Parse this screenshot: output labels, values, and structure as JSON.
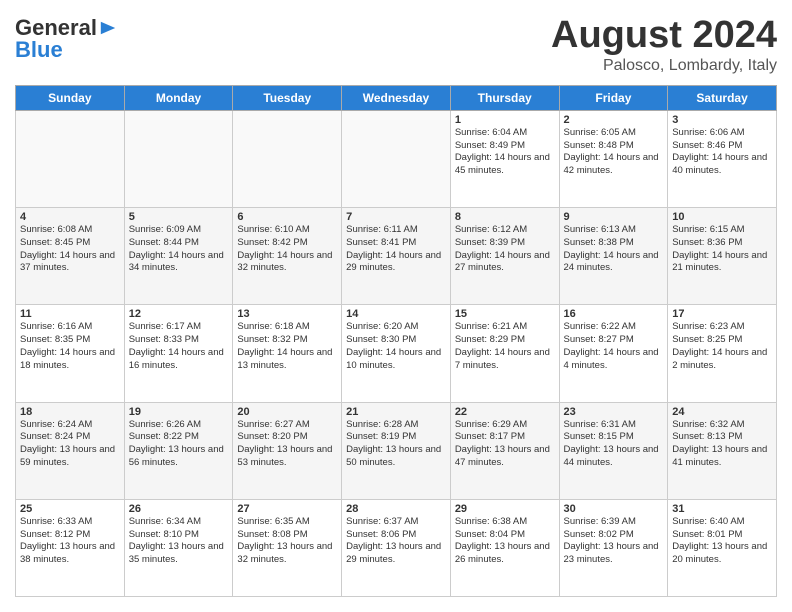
{
  "header": {
    "logo_line1": "General",
    "logo_line2": "Blue",
    "month_year": "August 2024",
    "location": "Palosco, Lombardy, Italy"
  },
  "days_of_week": [
    "Sunday",
    "Monday",
    "Tuesday",
    "Wednesday",
    "Thursday",
    "Friday",
    "Saturday"
  ],
  "weeks": [
    [
      {
        "day": "",
        "info": ""
      },
      {
        "day": "",
        "info": ""
      },
      {
        "day": "",
        "info": ""
      },
      {
        "day": "",
        "info": ""
      },
      {
        "day": "1",
        "info": "Sunrise: 6:04 AM\nSunset: 8:49 PM\nDaylight: 14 hours and 45 minutes."
      },
      {
        "day": "2",
        "info": "Sunrise: 6:05 AM\nSunset: 8:48 PM\nDaylight: 14 hours and 42 minutes."
      },
      {
        "day": "3",
        "info": "Sunrise: 6:06 AM\nSunset: 8:46 PM\nDaylight: 14 hours and 40 minutes."
      }
    ],
    [
      {
        "day": "4",
        "info": "Sunrise: 6:08 AM\nSunset: 8:45 PM\nDaylight: 14 hours and 37 minutes."
      },
      {
        "day": "5",
        "info": "Sunrise: 6:09 AM\nSunset: 8:44 PM\nDaylight: 14 hours and 34 minutes."
      },
      {
        "day": "6",
        "info": "Sunrise: 6:10 AM\nSunset: 8:42 PM\nDaylight: 14 hours and 32 minutes."
      },
      {
        "day": "7",
        "info": "Sunrise: 6:11 AM\nSunset: 8:41 PM\nDaylight: 14 hours and 29 minutes."
      },
      {
        "day": "8",
        "info": "Sunrise: 6:12 AM\nSunset: 8:39 PM\nDaylight: 14 hours and 27 minutes."
      },
      {
        "day": "9",
        "info": "Sunrise: 6:13 AM\nSunset: 8:38 PM\nDaylight: 14 hours and 24 minutes."
      },
      {
        "day": "10",
        "info": "Sunrise: 6:15 AM\nSunset: 8:36 PM\nDaylight: 14 hours and 21 minutes."
      }
    ],
    [
      {
        "day": "11",
        "info": "Sunrise: 6:16 AM\nSunset: 8:35 PM\nDaylight: 14 hours and 18 minutes."
      },
      {
        "day": "12",
        "info": "Sunrise: 6:17 AM\nSunset: 8:33 PM\nDaylight: 14 hours and 16 minutes."
      },
      {
        "day": "13",
        "info": "Sunrise: 6:18 AM\nSunset: 8:32 PM\nDaylight: 14 hours and 13 minutes."
      },
      {
        "day": "14",
        "info": "Sunrise: 6:20 AM\nSunset: 8:30 PM\nDaylight: 14 hours and 10 minutes."
      },
      {
        "day": "15",
        "info": "Sunrise: 6:21 AM\nSunset: 8:29 PM\nDaylight: 14 hours and 7 minutes."
      },
      {
        "day": "16",
        "info": "Sunrise: 6:22 AM\nSunset: 8:27 PM\nDaylight: 14 hours and 4 minutes."
      },
      {
        "day": "17",
        "info": "Sunrise: 6:23 AM\nSunset: 8:25 PM\nDaylight: 14 hours and 2 minutes."
      }
    ],
    [
      {
        "day": "18",
        "info": "Sunrise: 6:24 AM\nSunset: 8:24 PM\nDaylight: 13 hours and 59 minutes."
      },
      {
        "day": "19",
        "info": "Sunrise: 6:26 AM\nSunset: 8:22 PM\nDaylight: 13 hours and 56 minutes."
      },
      {
        "day": "20",
        "info": "Sunrise: 6:27 AM\nSunset: 8:20 PM\nDaylight: 13 hours and 53 minutes."
      },
      {
        "day": "21",
        "info": "Sunrise: 6:28 AM\nSunset: 8:19 PM\nDaylight: 13 hours and 50 minutes."
      },
      {
        "day": "22",
        "info": "Sunrise: 6:29 AM\nSunset: 8:17 PM\nDaylight: 13 hours and 47 minutes."
      },
      {
        "day": "23",
        "info": "Sunrise: 6:31 AM\nSunset: 8:15 PM\nDaylight: 13 hours and 44 minutes."
      },
      {
        "day": "24",
        "info": "Sunrise: 6:32 AM\nSunset: 8:13 PM\nDaylight: 13 hours and 41 minutes."
      }
    ],
    [
      {
        "day": "25",
        "info": "Sunrise: 6:33 AM\nSunset: 8:12 PM\nDaylight: 13 hours and 38 minutes."
      },
      {
        "day": "26",
        "info": "Sunrise: 6:34 AM\nSunset: 8:10 PM\nDaylight: 13 hours and 35 minutes."
      },
      {
        "day": "27",
        "info": "Sunrise: 6:35 AM\nSunset: 8:08 PM\nDaylight: 13 hours and 32 minutes."
      },
      {
        "day": "28",
        "info": "Sunrise: 6:37 AM\nSunset: 8:06 PM\nDaylight: 13 hours and 29 minutes."
      },
      {
        "day": "29",
        "info": "Sunrise: 6:38 AM\nSunset: 8:04 PM\nDaylight: 13 hours and 26 minutes."
      },
      {
        "day": "30",
        "info": "Sunrise: 6:39 AM\nSunset: 8:02 PM\nDaylight: 13 hours and 23 minutes."
      },
      {
        "day": "31",
        "info": "Sunrise: 6:40 AM\nSunset: 8:01 PM\nDaylight: 13 hours and 20 minutes."
      }
    ]
  ]
}
